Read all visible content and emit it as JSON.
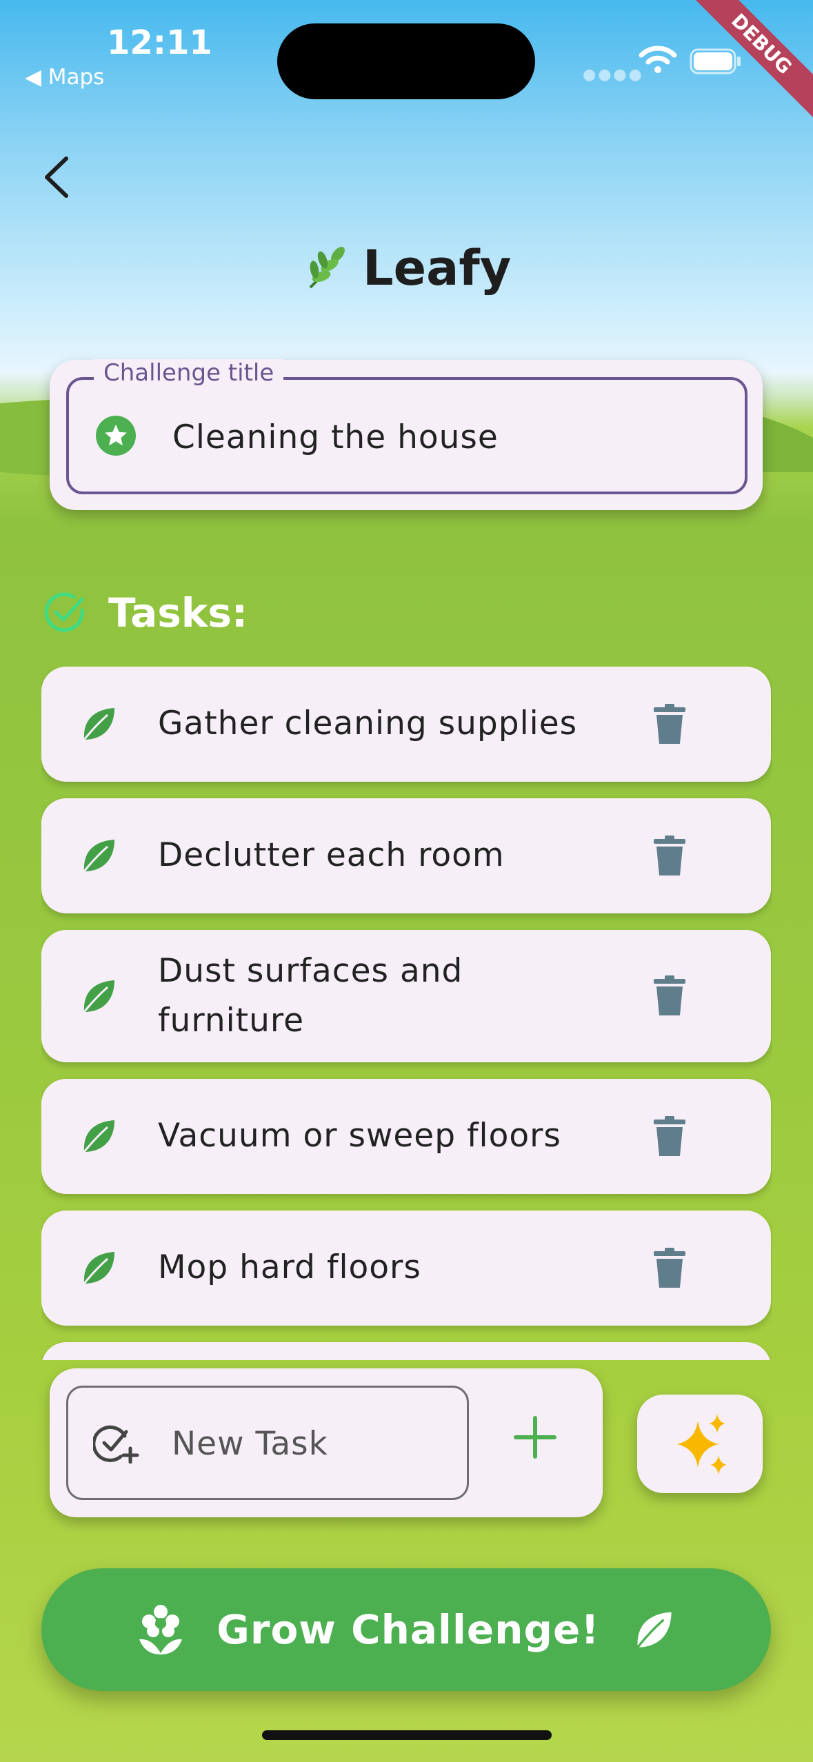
{
  "status_bar": {
    "time": "12:11",
    "back_app": "Maps"
  },
  "debug_banner": "DEBUG",
  "app_title": "Leafy",
  "challenge": {
    "label": "Challenge title",
    "value": "Cleaning the house"
  },
  "tasks_heading": "Tasks:",
  "tasks": [
    {
      "label": "Gather cleaning supplies"
    },
    {
      "label": "Declutter each room"
    },
    {
      "label": "Dust surfaces and\nfurniture"
    },
    {
      "label": "Vacuum or sweep floors"
    },
    {
      "label": "Mop hard floors"
    }
  ],
  "new_task": {
    "placeholder": "New Task"
  },
  "grow_button": {
    "label": "Grow Challenge!"
  },
  "colors": {
    "accent_green": "#4caf50",
    "outline_purple": "#6a5590",
    "card_bg": "#f6eff8",
    "trash_gray": "#607d8b",
    "sparkle_yellow": "#f9b800"
  },
  "icons": {
    "back": "chevron-left-icon",
    "title": "herb-icon",
    "challenge": "star-icon",
    "tasks": "check-circle-icon",
    "task": "leaf-icon",
    "delete": "trash-icon",
    "new_task": "add-task-icon",
    "add": "plus-icon",
    "ai": "sparkles-icon",
    "grow_left": "flower-icon",
    "grow_right": "leaf-icon"
  }
}
